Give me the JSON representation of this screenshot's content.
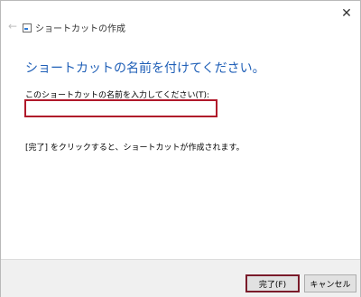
{
  "window": {
    "title": "ショートカットの作成",
    "close_label": "✕",
    "back_label": "←"
  },
  "main": {
    "heading": "ショートカットの名前を付けてください。",
    "name_label": "このショートカットの名前を入力してください(T):",
    "name_value": "",
    "hint": "[完了] をクリックすると、ショートカットが作成されます。"
  },
  "buttons": {
    "finish_label": "完了(F)",
    "cancel_label": "キャンセル"
  },
  "colors": {
    "heading": "#1f5fb7",
    "highlight_border": "#b0182a"
  }
}
